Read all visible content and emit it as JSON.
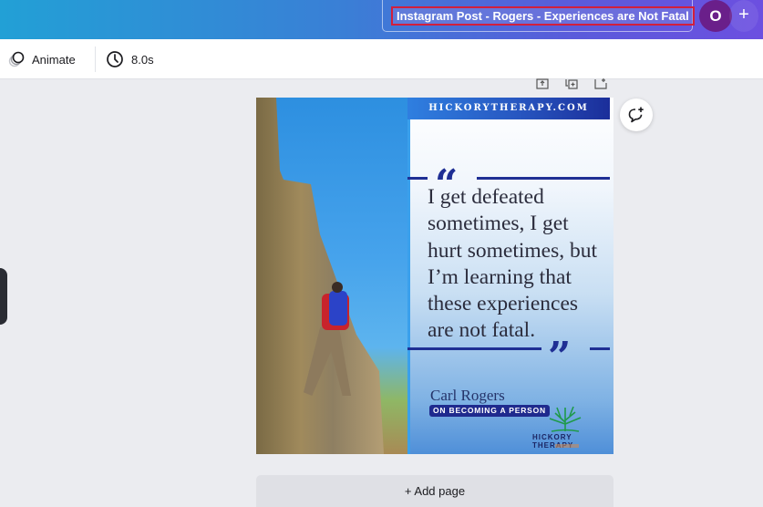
{
  "header": {
    "document_title": "Instagram Post - Rogers - Experiences are Not Fatal",
    "avatar_initial": "O",
    "add_collaborator_label": "+"
  },
  "toolbar": {
    "animate_label": "Animate",
    "duration_label": "8.0s"
  },
  "page_tools": {
    "icons": [
      "page-notes-icon",
      "duplicate-page-icon",
      "add-page-icon"
    ]
  },
  "design": {
    "site_banner": "HICKORYTHERAPY.COM",
    "open_quote": "“",
    "close_quote": "”",
    "quote_lines": [
      "I get defeated",
      "sometimes, I get",
      "hurt sometimes, but",
      "I’m learning that",
      "these experiences",
      "are not fatal."
    ],
    "author": "Carl Rogers",
    "book_title": "ON BECOMING A PERSON",
    "logo_text": "HICKORY THERAPY",
    "colors": {
      "quote_accent": "#1f2f94",
      "banner_dark": "#1b2e9a",
      "book_badge": "#1f2a8e"
    }
  },
  "footer": {
    "add_page_label": "+ Add page"
  },
  "colors": {
    "title_highlight_border": "#d21f3c",
    "avatar_bg": "#6a1f8a"
  }
}
